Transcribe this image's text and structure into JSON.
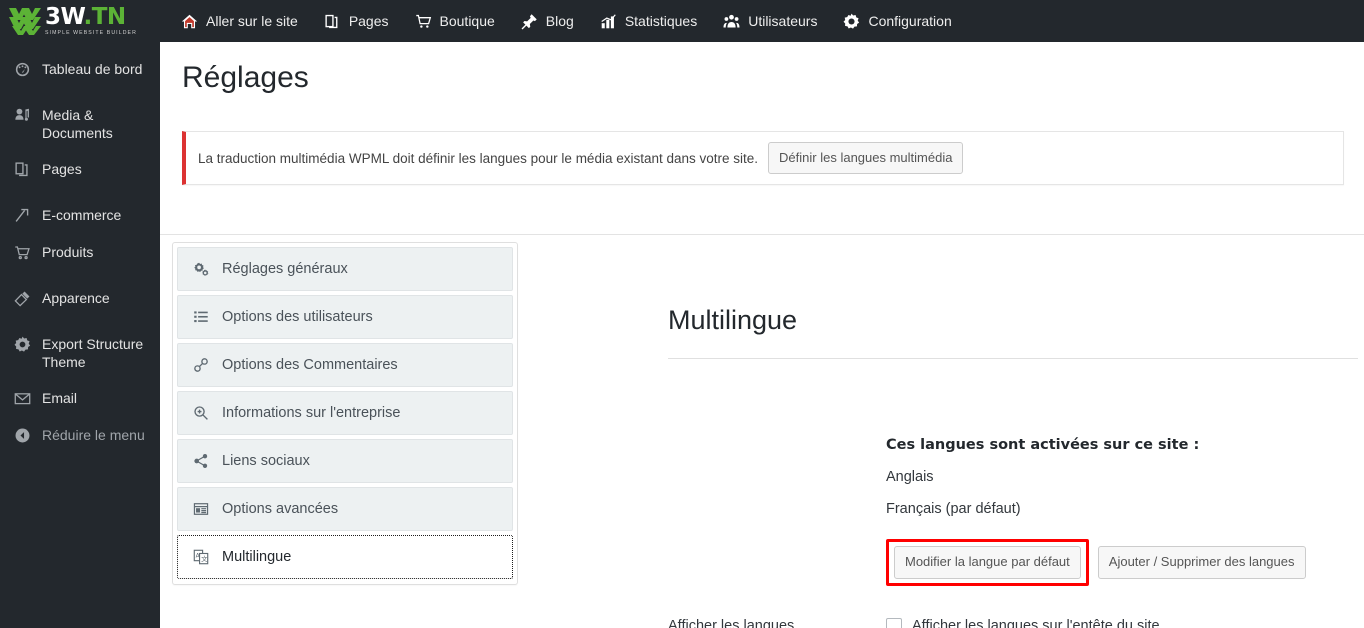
{
  "brand": {
    "name_white": "3W",
    "name_green": ".TN",
    "tagline": "SIMPLE WEBSITE BUILDER",
    "logo_color": "#5cb336"
  },
  "adminbar": {
    "items": [
      {
        "label": "Aller sur le site",
        "icon": "home-icon"
      },
      {
        "label": "Pages",
        "icon": "pages-icon"
      },
      {
        "label": "Boutique",
        "icon": "cart-icon"
      },
      {
        "label": "Blog",
        "icon": "pin-icon"
      },
      {
        "label": "Statistiques",
        "icon": "chart-icon"
      },
      {
        "label": "Utilisateurs",
        "icon": "users-icon"
      },
      {
        "label": "Configuration",
        "icon": "gear-icon"
      }
    ]
  },
  "sidebar": {
    "items": [
      {
        "label": "Tableau de bord",
        "icon": "dashboard-icon"
      },
      {
        "label": "Media & Documents",
        "icon": "media-icon"
      },
      {
        "label": "Pages",
        "icon": "pages-icon"
      },
      {
        "label": "E-commerce",
        "icon": "ecommerce-icon"
      },
      {
        "label": "Produits",
        "icon": "cart-icon"
      },
      {
        "label": "Apparence",
        "icon": "brush-icon"
      },
      {
        "label": "Export Structure Theme",
        "icon": "gear-icon"
      },
      {
        "label": "Email",
        "icon": "envelope-icon"
      }
    ],
    "collapse_label": "Réduire le menu",
    "collapse_icon": "collapse-arrow-icon"
  },
  "page": {
    "title": "Réglages"
  },
  "notice": {
    "text": "La traduction multimédia WPML doit définir les langues pour le média existant dans votre site.",
    "button_label": "Définir les langues multimédia",
    "accent_color": "#dc3232"
  },
  "settings_nav": {
    "items": [
      {
        "label": "Réglages généraux",
        "icon": "cogs-icon",
        "active": false
      },
      {
        "label": "Options des utilisateurs",
        "icon": "list-icon",
        "active": false
      },
      {
        "label": "Options des Commentaires",
        "icon": "link-icon",
        "active": false
      },
      {
        "label": "Informations sur l'entreprise",
        "icon": "search-plus-icon",
        "active": false
      },
      {
        "label": "Liens sociaux",
        "icon": "share-icon",
        "active": false
      },
      {
        "label": "Options avancées",
        "icon": "window-icon",
        "active": false
      },
      {
        "label": "Multilingue",
        "icon": "translate-icon",
        "active": true
      }
    ]
  },
  "multilingue": {
    "title": "Multilingue",
    "languages_heading": "Ces langues sont activées sur ce site :",
    "languages": [
      "Anglais",
      "Français (par défaut)"
    ],
    "edit_default_button": "Modifier la langue par défaut",
    "add_remove_button": "Ajouter / Supprimer des langues",
    "highlight_color": "#ff0000",
    "show_languages_label": "Afficher les langues",
    "show_languages_checkbox_label": "Afficher les langues sur l'entête du site",
    "show_languages_checked": false
  }
}
